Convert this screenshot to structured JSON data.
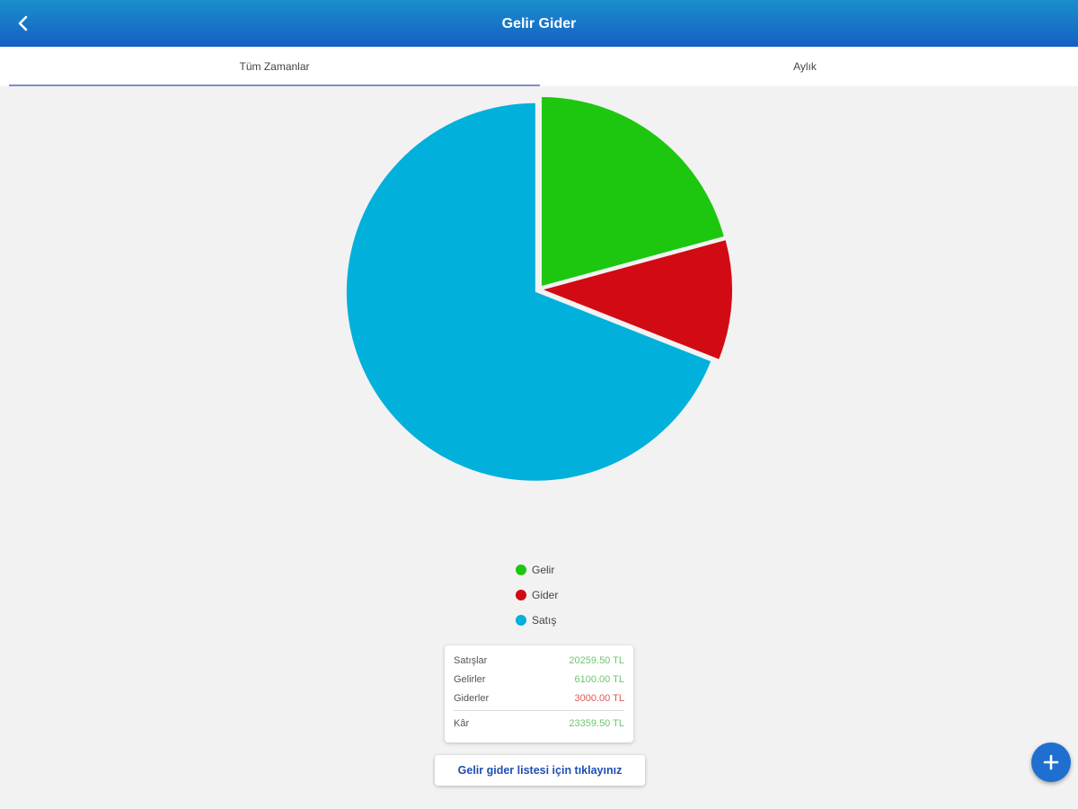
{
  "header": {
    "title": "Gelir Gider",
    "back_icon": "back-chevron-icon"
  },
  "tabs": [
    {
      "label": "Tüm Zamanlar",
      "active": true
    },
    {
      "label": "Aylık",
      "active": false
    }
  ],
  "chart_data": {
    "type": "pie",
    "title": "",
    "series": [
      {
        "name": "Gelir",
        "value": 6100.0,
        "color": "#1dc710"
      },
      {
        "name": "Gider",
        "value": 3000.0,
        "color": "#d10a14"
      },
      {
        "name": "Satış",
        "value": 20259.5,
        "color": "#02b0dc"
      }
    ],
    "legend_position": "bottom"
  },
  "summary": {
    "rows": [
      {
        "label": "Satışlar",
        "value": "20259.50 TL",
        "type": "positive"
      },
      {
        "label": "Gelirler",
        "value": "6100.00 TL",
        "type": "positive"
      },
      {
        "label": "Giderler",
        "value": "3000.00 TL",
        "type": "negative"
      }
    ],
    "total": {
      "label": "Kâr",
      "value": "23359.50 TL",
      "type": "positive"
    }
  },
  "list_button": {
    "label": "Gelir gider listesi için tıklayınız"
  },
  "fab": {
    "icon": "plus-icon"
  },
  "colors": {
    "header_start": "#1a8fcc",
    "header_end": "#1560c4",
    "positive": "#6cc76c",
    "negative": "#e05858",
    "link": "#1f4fb3"
  }
}
